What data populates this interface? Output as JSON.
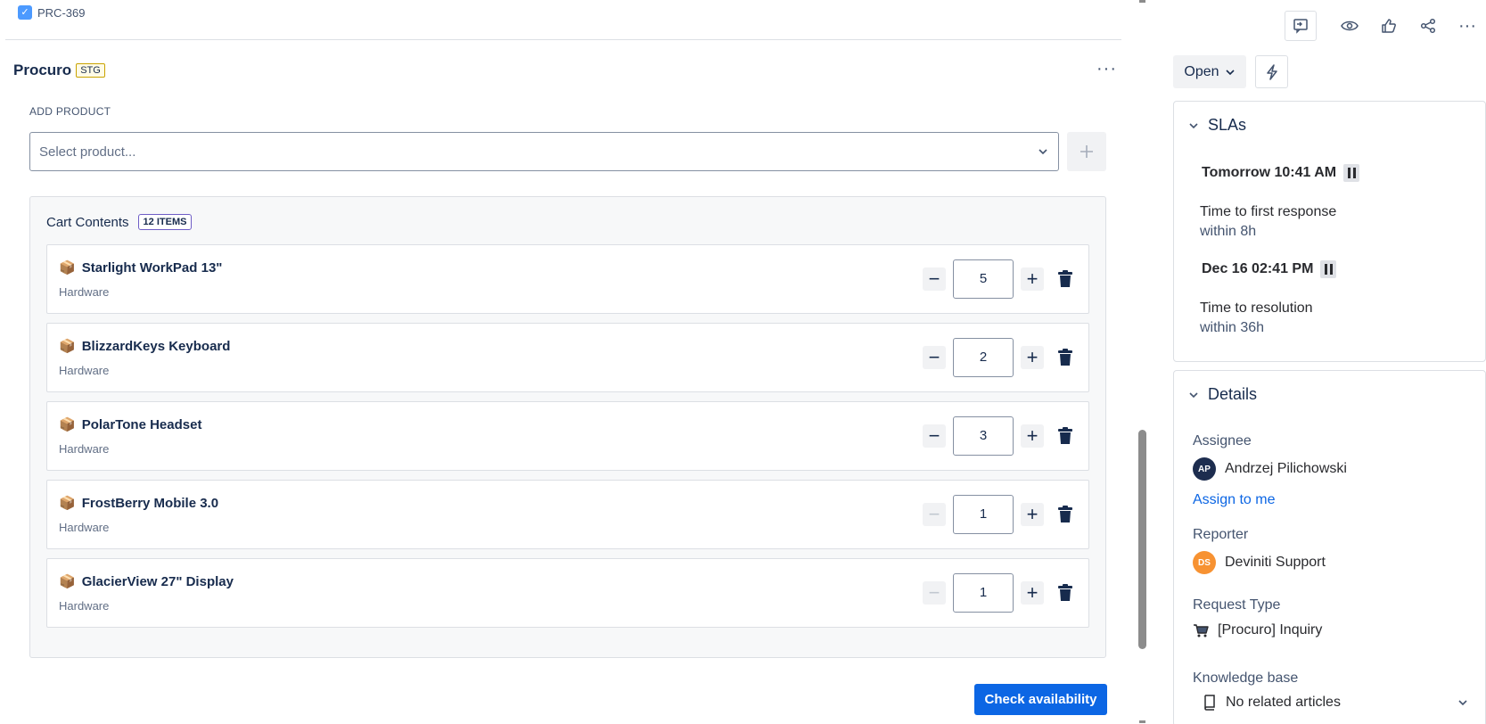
{
  "issue": {
    "key": "PRC-369"
  },
  "app": {
    "name": "Procuro",
    "env_badge": "STG"
  },
  "add_product": {
    "label": "ADD PRODUCT",
    "placeholder": "Select product..."
  },
  "cart": {
    "title": "Cart Contents",
    "count_badge": "12 ITEMS",
    "items": [
      {
        "name": "Starlight WorkPad 13\"",
        "category": "Hardware",
        "qty": "5",
        "decrement_disabled": false
      },
      {
        "name": "BlizzardKeys Keyboard",
        "category": "Hardware",
        "qty": "2",
        "decrement_disabled": false
      },
      {
        "name": "PolarTone Headset",
        "category": "Hardware",
        "qty": "3",
        "decrement_disabled": false
      },
      {
        "name": "FrostBerry Mobile 3.0",
        "category": "Hardware",
        "qty": "1",
        "decrement_disabled": true
      },
      {
        "name": "GlacierView 27\" Display",
        "category": "Hardware",
        "qty": "1",
        "decrement_disabled": true
      }
    ]
  },
  "check_button": {
    "label": "Check availability"
  },
  "status": {
    "label": "Open"
  },
  "slas": {
    "title": "SLAs",
    "entries": [
      {
        "time": "Tomorrow 10:41 AM",
        "name": "Time to first response",
        "target": "within 8h"
      },
      {
        "time": "Dec 16 02:41 PM",
        "name": "Time to resolution",
        "target": "within 36h"
      }
    ]
  },
  "details": {
    "title": "Details",
    "assignee_label": "Assignee",
    "assignee": {
      "initials": "AP",
      "name": "Andrzej Pilichowski",
      "color": "#1d2d4f"
    },
    "assign_link": "Assign to me",
    "reporter_label": "Reporter",
    "reporter": {
      "initials": "DS",
      "name": "Deviniti Support",
      "color": "#f79232"
    },
    "request_type_label": "Request Type",
    "request_type": "[Procuro] Inquiry",
    "kb_label": "Knowledge base",
    "kb_value": "No related articles"
  },
  "colors": {
    "primary": "#0c66e4",
    "text": "#172b4d",
    "border": "#dcdfe4"
  }
}
